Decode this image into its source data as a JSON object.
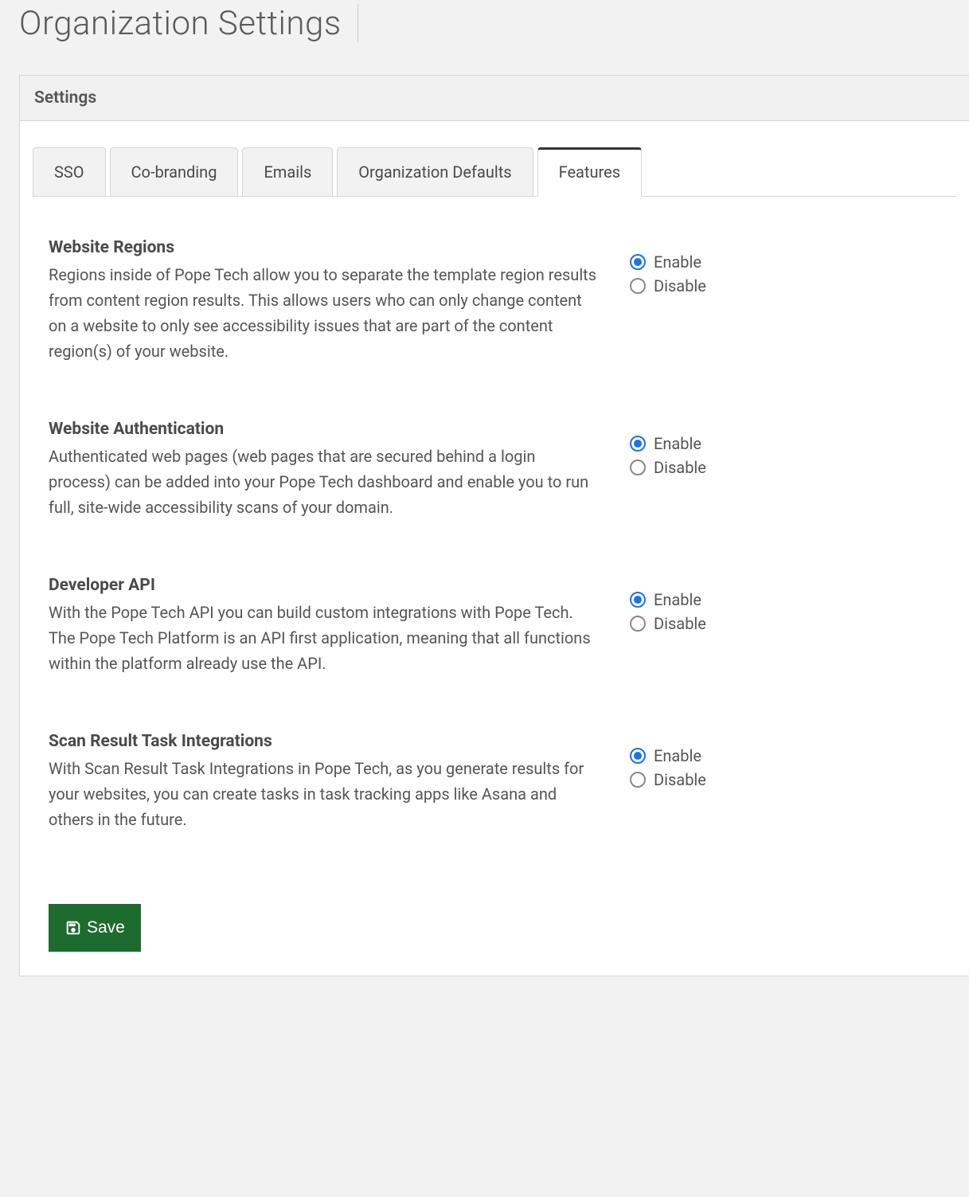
{
  "page_title": "Organization Settings",
  "panel_title": "Settings",
  "tabs": [
    {
      "label": "SSO",
      "active": false
    },
    {
      "label": "Co-branding",
      "active": false
    },
    {
      "label": "Emails",
      "active": false
    },
    {
      "label": "Organization Defaults",
      "active": false
    },
    {
      "label": "Features",
      "active": true
    }
  ],
  "radio_labels": {
    "enable": "Enable",
    "disable": "Disable"
  },
  "features": [
    {
      "title": "Website Regions",
      "description": "Regions inside of Pope Tech allow you to separate the template region results from content region results. This allows users who can only change content on a website to only see accessibility issues that are part of the content region(s) of your website.",
      "value": "enable"
    },
    {
      "title": "Website Authentication",
      "description": "Authenticated web pages (web pages that are secured behind a login process) can be added into your Pope Tech dashboard and enable you to run full, site-wide accessibility scans of your domain.",
      "value": "enable"
    },
    {
      "title": "Developer API",
      "description": "With the Pope Tech API you can build custom integrations with Pope Tech. The Pope Tech Platform is an API first application, meaning that all functions within the platform already use the API.",
      "value": "enable"
    },
    {
      "title": "Scan Result Task Integrations",
      "description": "With Scan Result Task Integrations in Pope Tech, as you generate results for your websites, you can create tasks in task tracking apps like Asana and others in the future.",
      "value": "enable"
    }
  ],
  "save_button_label": "Save"
}
